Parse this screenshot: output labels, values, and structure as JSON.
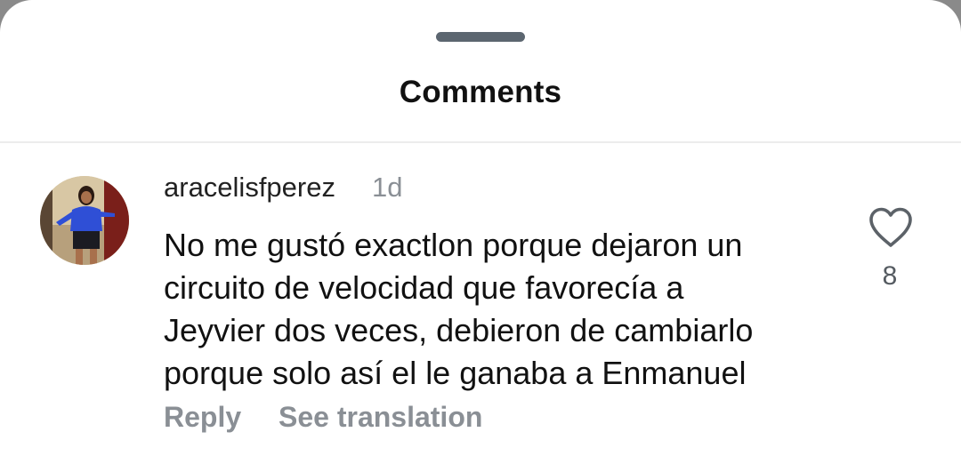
{
  "sheet": {
    "title": "Comments"
  },
  "comment": {
    "username": "aracelisfperez",
    "time_ago": "1d",
    "text_lines": [
      "No me gustó exactlon porque dejaron un",
      "circuito de velocidad que favorecía a",
      "Jeyvier dos veces, debieron de cambiarlo",
      "porque solo así el le ganaba a Enmanuel"
    ],
    "like_count": "8",
    "like_icon": "heart-outline-icon",
    "reply_label": "Reply",
    "translate_label": "See translation"
  },
  "colors": {
    "background": "#ffffff",
    "text_primary": "#111111",
    "text_secondary": "#8a8f95",
    "handle": "#5c6670"
  }
}
